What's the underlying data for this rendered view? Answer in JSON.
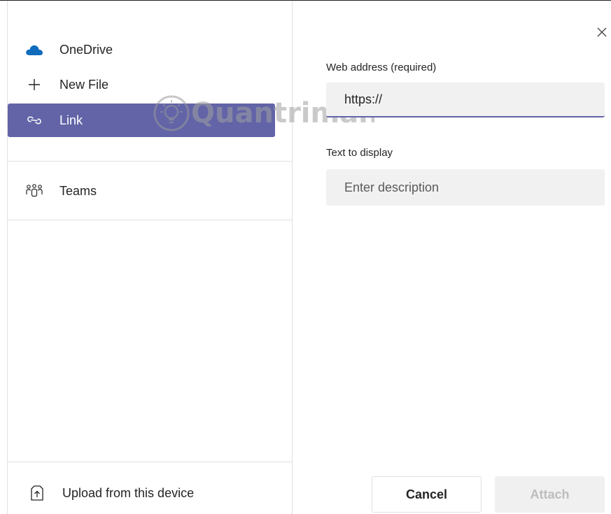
{
  "nav": {
    "items": [
      {
        "label": "OneDrive",
        "icon": "onedrive-cloud-icon"
      },
      {
        "label": "New File",
        "icon": "plus-icon"
      },
      {
        "label": "Link",
        "icon": "link-icon",
        "active": true
      },
      {
        "label": "Teams",
        "icon": "teams-icon"
      }
    ],
    "upload_label": "Upload from this device"
  },
  "form": {
    "web_address_label": "Web address (required)",
    "web_address_value": "https://",
    "display_text_label": "Text to display",
    "display_text_placeholder": "Enter description"
  },
  "buttons": {
    "cancel": "Cancel",
    "attach": "Attach"
  },
  "colors": {
    "accent": "#6264a7",
    "onedrive": "#0f6cbd",
    "input_bg": "#f1f1f1"
  },
  "watermark": "Quantrimang"
}
